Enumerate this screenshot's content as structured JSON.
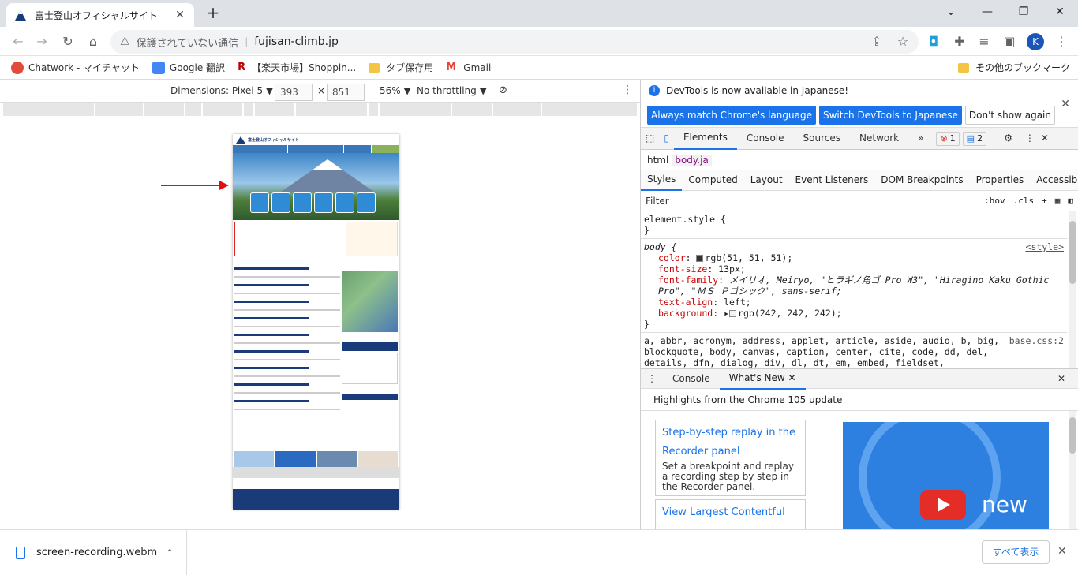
{
  "browser": {
    "tab_title": "富士登山オフィシャルサイト",
    "tab_close": "✕",
    "new_tab": "+",
    "window": {
      "minimize": "⌄",
      "restore": "—",
      "maximize": "❐",
      "close": "✕"
    },
    "security_text": "保護されていない通信",
    "url": "fujisan-climb.jp",
    "profile_initial": "K",
    "bookmarks": [
      {
        "label": "Chatwork - マイチャット",
        "color": "#e24b3b"
      },
      {
        "label": "Google 翻訳",
        "color": "#4285f4"
      },
      {
        "label": "【楽天市場】Shoppin...",
        "color": "#bf0000"
      },
      {
        "label": "タブ保存用",
        "color": "#f4c542"
      },
      {
        "label": "Gmail",
        "color": "#ea4335"
      }
    ],
    "other_bookmarks": "その他のブックマーク"
  },
  "device_toolbar": {
    "dimensions_label": "Dimensions: Pixel 5 ▼",
    "width": "393",
    "times": "×",
    "height": "851",
    "zoom": "56% ▼",
    "throttling": "No throttling ▼"
  },
  "mobile_page": {
    "site_title": "富士登山オフィシャルサイト"
  },
  "devtools": {
    "lang_msg": "DevTools is now available in Japanese!",
    "btn_match": "Always match Chrome's language",
    "btn_switch": "Switch DevTools to Japanese",
    "btn_dismiss": "Don't show again",
    "tabs": [
      "Elements",
      "Console",
      "Sources",
      "Network"
    ],
    "more_tabs": "»",
    "errors": "1",
    "messages": "2",
    "crumbs": [
      "html",
      "body.ja"
    ],
    "subtabs": [
      "Styles",
      "Computed",
      "Layout",
      "Event Listeners",
      "DOM Breakpoints",
      "Properties",
      "Accessibility"
    ],
    "filter_placeholder": "Filter",
    "hov": ":hov",
    "cls": ".cls",
    "element_style": "element.style {",
    "close_brace": "}",
    "body_selector": "body {",
    "style_src": "<style>",
    "props": [
      {
        "name": "color",
        "value": "rgb(51, 51, 51);"
      },
      {
        "name": "font-size",
        "value": "13px;"
      },
      {
        "name": "font-family",
        "value": "メイリオ, Meiryo, \"ヒラギノ角ゴ Pro W3\", \"Hiragino Kaku Gothic Pro\", \"ＭＳ Ｐゴシック\", sans-serif;"
      },
      {
        "name": "text-align",
        "value": "left;"
      },
      {
        "name": "background",
        "value": "rgb(242, 242, 242);"
      }
    ],
    "reset_rule": "a, abbr, acronym, address, applet, article, aside, audio, b, big, blockquote, body, canvas, caption, center, cite, code, dd, del, details, dfn, dialog, div, dl, dt, em, embed, fieldset, figcaption, figure, font, footer,",
    "reset_src": "base.css:2",
    "drawer_tabs": [
      "Console",
      "What's New"
    ],
    "whats_new_heading": "Highlights from the Chrome 105 update",
    "card1_title": "Step-by-step replay in the Recorder panel",
    "card1_desc": "Set a breakpoint and replay a recording step by step in the Recorder panel.",
    "card2_title": "View Largest Contentful",
    "promo_text": "new"
  },
  "downloads": {
    "file": "screen-recording.webm",
    "show_all": "すべて表示"
  },
  "colors": {
    "accent": "#1a73e8",
    "arrow": "#e01010"
  }
}
